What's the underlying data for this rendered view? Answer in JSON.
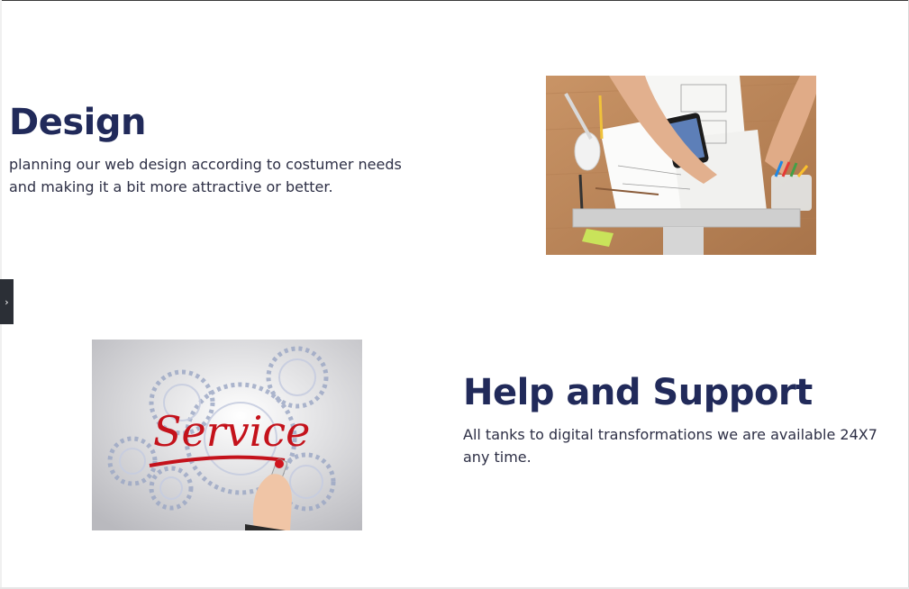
{
  "sections": {
    "design": {
      "title": "Design",
      "text": "planning our web design according to costumer needs and making it a bit more attractive or better."
    },
    "help": {
      "title": "Help and Support",
      "text": "All tanks to digital transformations we are available 24X7 any time."
    }
  },
  "images": {
    "service_sign": "Service"
  },
  "sidebar_toggle": {
    "icon": "chevron-right-icon",
    "glyph": "›"
  },
  "colors": {
    "heading": "#212a5a",
    "body_text": "#2d2f45",
    "service_red": "#c4121b",
    "toggle_bg": "#2b2f36"
  }
}
